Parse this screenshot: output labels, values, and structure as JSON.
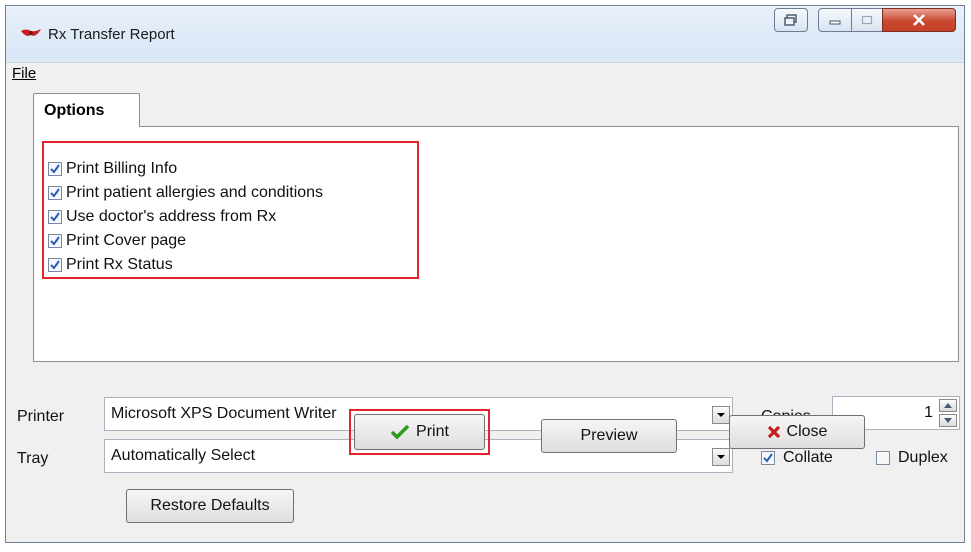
{
  "window": {
    "title": "Rx Transfer Report"
  },
  "menu": {
    "file_label": "File"
  },
  "tabs": [
    {
      "label": "Options"
    }
  ],
  "options": [
    {
      "label": "Print Billing Info",
      "checked": true
    },
    {
      "label": "Print patient allergies and conditions",
      "checked": true
    },
    {
      "label": "Use doctor's address from Rx",
      "checked": true
    },
    {
      "label": "Print Cover page",
      "checked": true
    },
    {
      "label": "Print Rx Status",
      "checked": true
    }
  ],
  "printer": {
    "label": "Printer",
    "value": "Microsoft XPS Document Writer"
  },
  "tray": {
    "label": "Tray",
    "value": "Automatically Select"
  },
  "copies": {
    "label": "Copies",
    "value": "1"
  },
  "collate": {
    "label": "Collate",
    "checked": true
  },
  "duplex": {
    "label": "Duplex",
    "checked": false
  },
  "buttons": {
    "restore_defaults": {
      "label": "Restore Defaults"
    },
    "print": {
      "label": "Print"
    },
    "preview": {
      "label": "Preview"
    },
    "close": {
      "label": "Close"
    }
  },
  "colors": {
    "highlight": "#e0242e",
    "check": "#2b5fb7",
    "close_x": "#c0201c",
    "print_check": "#2f9a1f"
  }
}
